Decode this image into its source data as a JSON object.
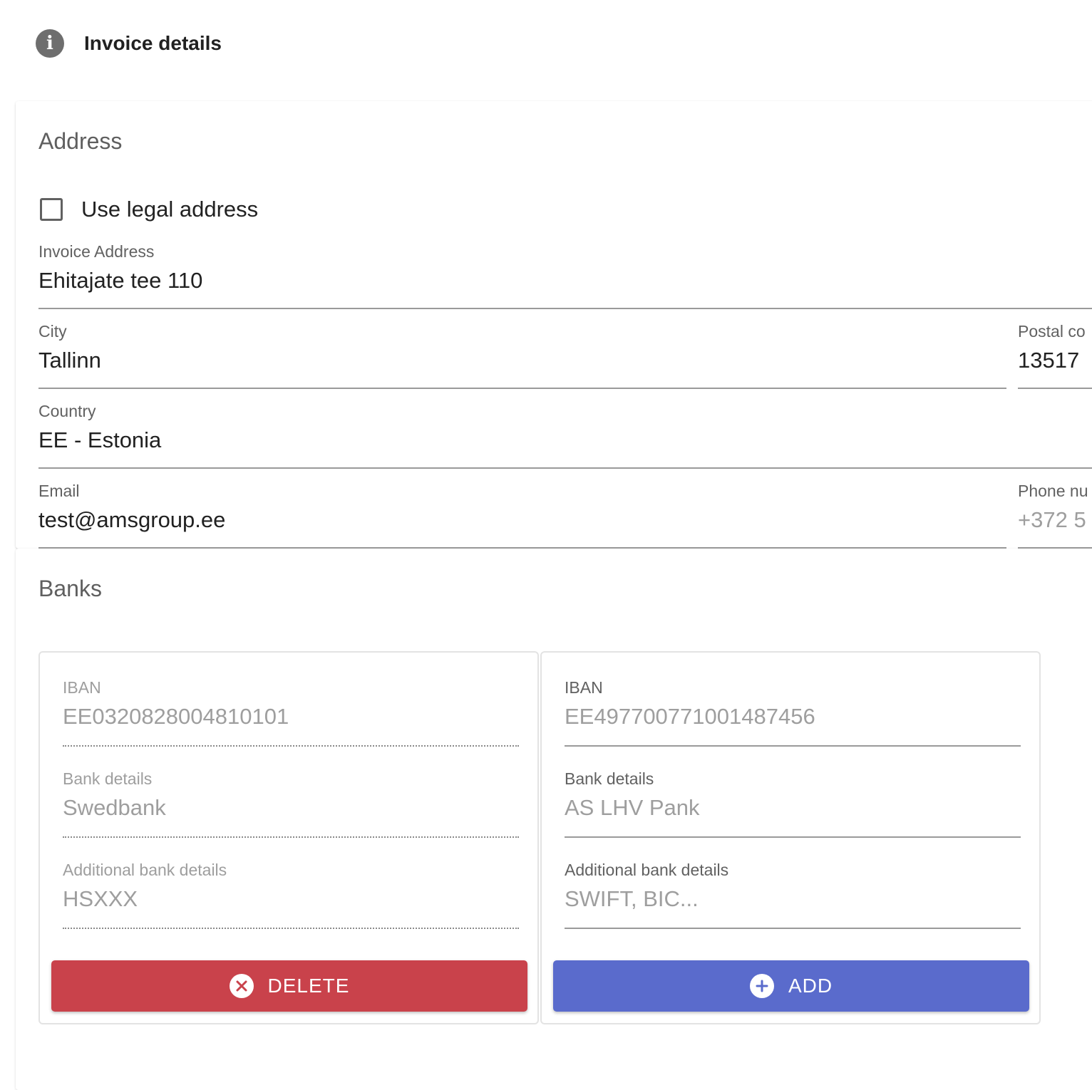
{
  "header": {
    "icon": "info-icon",
    "title": "Invoice details"
  },
  "address": {
    "title": "Address",
    "use_legal_address": {
      "label": "Use legal address",
      "checked": false
    },
    "invoice_address": {
      "label": "Invoice Address",
      "value": "Ehitajate tee 110"
    },
    "city": {
      "label": "City",
      "value": "Tallinn"
    },
    "postal_code": {
      "label": "Postal co",
      "value": "13517"
    },
    "country": {
      "label": "Country",
      "value": "EE - Estonia"
    },
    "email": {
      "label": "Email",
      "value": "test@amsgroup.ee"
    },
    "phone": {
      "label": "Phone nu",
      "placeholder": "+372 5"
    }
  },
  "banks": {
    "title": "Banks",
    "items": [
      {
        "iban_label": "IBAN",
        "iban": "EE032082800481010​1",
        "bank_details_label": "Bank details",
        "bank_details": "Swedbank",
        "additional_label": "Additional bank details",
        "additional": "HSXXX",
        "button_label": "DELETE",
        "button_icon": "close-circle-icon"
      },
      {
        "iban_label": "IBAN",
        "iban_placeholder": "EE497700771001487456",
        "bank_details_label": "Bank details",
        "bank_details_placeholder": "AS LHV Pank",
        "additional_label": "Additional bank details",
        "additional_placeholder": "SWIFT, BIC...",
        "button_label": "ADD",
        "button_icon": "plus-circle-icon"
      }
    ]
  },
  "colors": {
    "delete": "#c9424b",
    "add": "#5a6bcc"
  }
}
